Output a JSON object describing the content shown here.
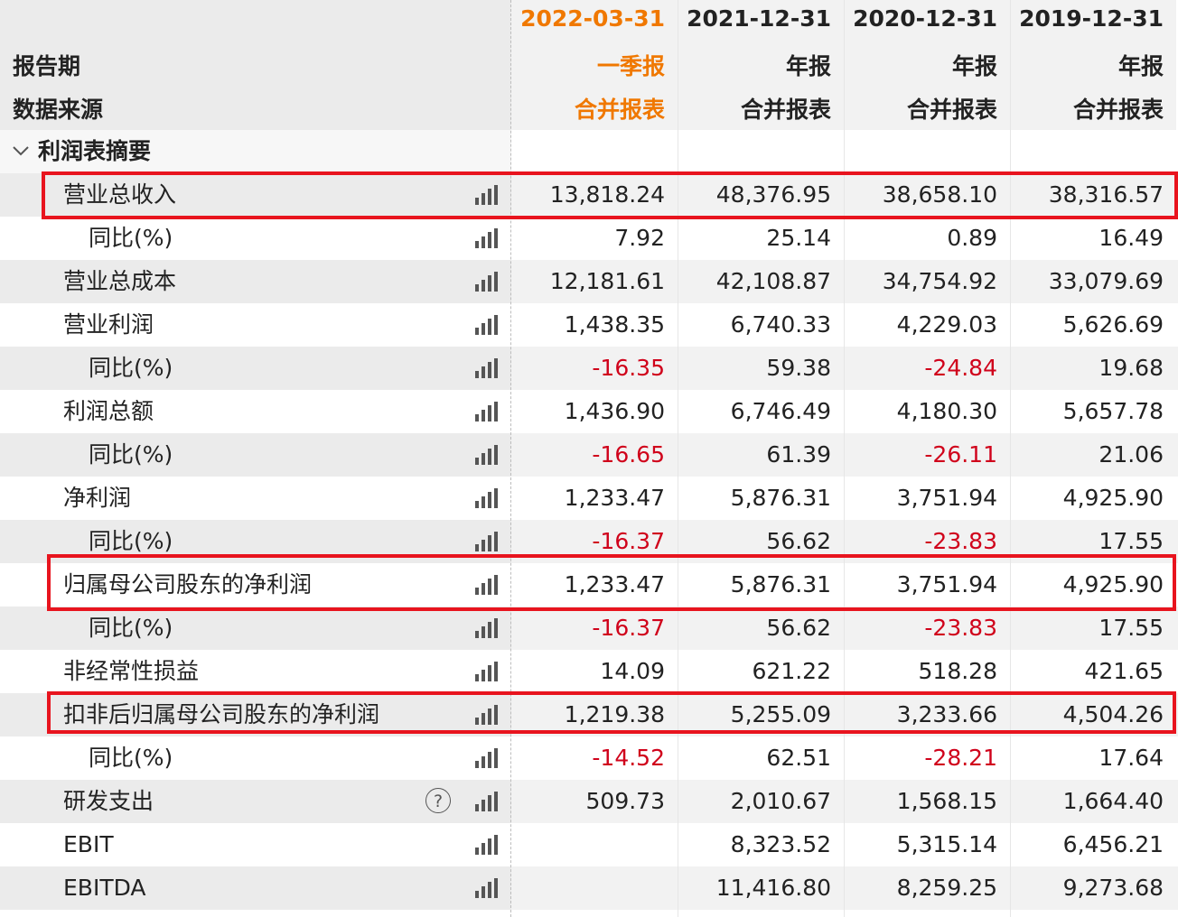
{
  "header": {
    "report_period_label": "报告期",
    "data_source_label": "数据来源",
    "columns": [
      {
        "date": "2022-03-31",
        "period": "一季报",
        "source": "合并报表"
      },
      {
        "date": "2021-12-31",
        "period": "年报",
        "source": "合并报表"
      },
      {
        "date": "2020-12-31",
        "period": "年报",
        "source": "合并报表"
      },
      {
        "date": "2019-12-31",
        "period": "年报",
        "source": "合并报表"
      }
    ]
  },
  "section": {
    "title": "利润表摘要",
    "icon": "chevron-down-icon"
  },
  "rows": [
    {
      "label": "营业总收入",
      "level": 1,
      "values": [
        "13,818.24",
        "48,376.95",
        "38,658.10",
        "38,316.57"
      ],
      "highlighted": true
    },
    {
      "label": "同比(%)",
      "level": 2,
      "values": [
        "7.92",
        "25.14",
        "0.89",
        "16.49"
      ]
    },
    {
      "label": "营业总成本",
      "level": 1,
      "values": [
        "12,181.61",
        "42,108.87",
        "34,754.92",
        "33,079.69"
      ]
    },
    {
      "label": "营业利润",
      "level": 1,
      "values": [
        "1,438.35",
        "6,740.33",
        "4,229.03",
        "5,626.69"
      ]
    },
    {
      "label": "同比(%)",
      "level": 2,
      "values": [
        "-16.35",
        "59.38",
        "-24.84",
        "19.68"
      ]
    },
    {
      "label": "利润总额",
      "level": 1,
      "values": [
        "1,436.90",
        "6,746.49",
        "4,180.30",
        "5,657.78"
      ]
    },
    {
      "label": "同比(%)",
      "level": 2,
      "values": [
        "-16.65",
        "61.39",
        "-26.11",
        "21.06"
      ]
    },
    {
      "label": "净利润",
      "level": 1,
      "values": [
        "1,233.47",
        "5,876.31",
        "3,751.94",
        "4,925.90"
      ]
    },
    {
      "label": "同比(%)",
      "level": 2,
      "values": [
        "-16.37",
        "56.62",
        "-23.83",
        "17.55"
      ]
    },
    {
      "label": "归属母公司股东的净利润",
      "level": 1,
      "values": [
        "1,233.47",
        "5,876.31",
        "3,751.94",
        "4,925.90"
      ],
      "highlighted": true
    },
    {
      "label": "同比(%)",
      "level": 2,
      "values": [
        "-16.37",
        "56.62",
        "-23.83",
        "17.55"
      ]
    },
    {
      "label": "非经常性损益",
      "level": 1,
      "values": [
        "14.09",
        "621.22",
        "518.28",
        "421.65"
      ]
    },
    {
      "label": "扣非后归属母公司股东的净利润",
      "level": 1,
      "values": [
        "1,219.38",
        "5,255.09",
        "3,233.66",
        "4,504.26"
      ],
      "highlighted": true
    },
    {
      "label": "同比(%)",
      "level": 2,
      "values": [
        "-14.52",
        "62.51",
        "-28.21",
        "17.64"
      ]
    },
    {
      "label": "研发支出",
      "level": 1,
      "values": [
        "509.73",
        "2,010.67",
        "1,568.15",
        "1,664.40"
      ],
      "help_icon": "?"
    },
    {
      "label": "EBIT",
      "level": 1,
      "values": [
        "",
        "8,323.52",
        "5,315.14",
        "6,456.21"
      ]
    },
    {
      "label": "EBITDA",
      "level": 1,
      "values": [
        "",
        "11,416.80",
        "8,259.25",
        "9,273.68"
      ]
    }
  ],
  "colors": {
    "current_column": "#f07800",
    "negative": "#d0021b",
    "highlight_box": "#e8141e"
  }
}
